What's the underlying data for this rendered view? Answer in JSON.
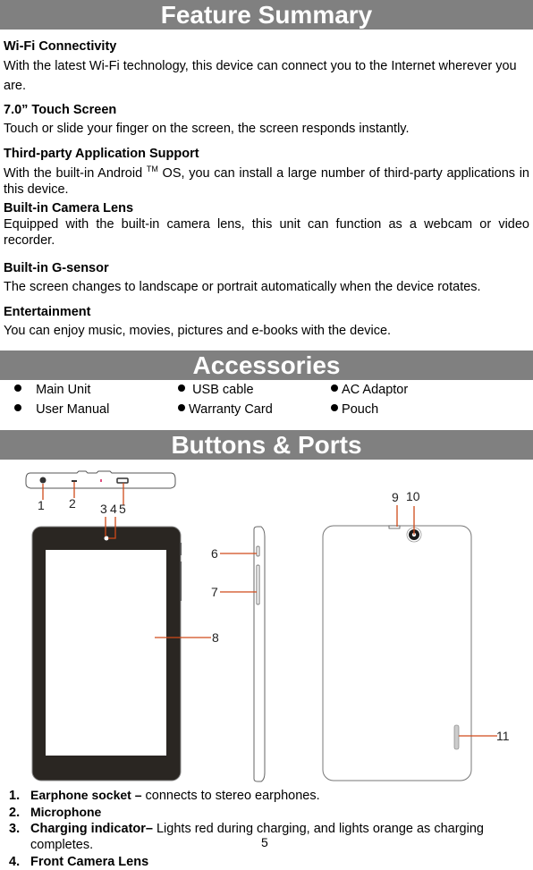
{
  "sections": {
    "feature_summary": {
      "title": "Feature Summary",
      "items": [
        {
          "heading": "Wi-Fi Connectivity",
          "text": "With the latest Wi-Fi technology, this device can connect you to the Internet wherever you are."
        },
        {
          "heading": "7.0” Touch Screen",
          "text": "Touch or slide your finger on the screen, the screen responds instantly."
        },
        {
          "heading": "Third-party Application Support",
          "text_before_tm": "With the built-in Android",
          "tm": "TM",
          "text_after_tm": " OS, you can install a large number of third-party applications in this device."
        },
        {
          "heading": "Built-in Camera Lens",
          "text": "Equipped with the built-in camera lens, this unit can function as a webcam or video recorder."
        },
        {
          "heading": "Built-in G-sensor",
          "text": "The screen changes to landscape or portrait automatically when the device rotates."
        },
        {
          "heading": "Entertainment",
          "text": "You can enjoy music, movies, pictures and e-books with the device."
        }
      ]
    },
    "accessories": {
      "title": "Accessories",
      "items": [
        "Main Unit",
        "USB cable",
        "AC Adaptor",
        "User Manual",
        "Warranty Card",
        "Pouch"
      ]
    },
    "buttons_ports": {
      "title": "Buttons & Ports",
      "callouts": [
        "1",
        "2",
        "3",
        "4",
        "5",
        "6",
        "7",
        "8",
        "9",
        "10",
        "11"
      ],
      "list": [
        {
          "num": "1.",
          "title": "Earphone socket –",
          "desc": " connects to stereo earphones."
        },
        {
          "num": "2.",
          "title": "Microphone",
          "desc": ""
        },
        {
          "num": "3.",
          "title": "Charging indicator–",
          "desc": " Lights red during charging, and lights orange as charging",
          "desc_cont": "completes."
        },
        {
          "num": "4.",
          "title": "Front Camera Lens",
          "desc": ""
        }
      ]
    }
  },
  "page_number": "5",
  "colors": {
    "banner": "#808080",
    "callout_line": "#d04a1a",
    "bezel": "#2a2622"
  }
}
